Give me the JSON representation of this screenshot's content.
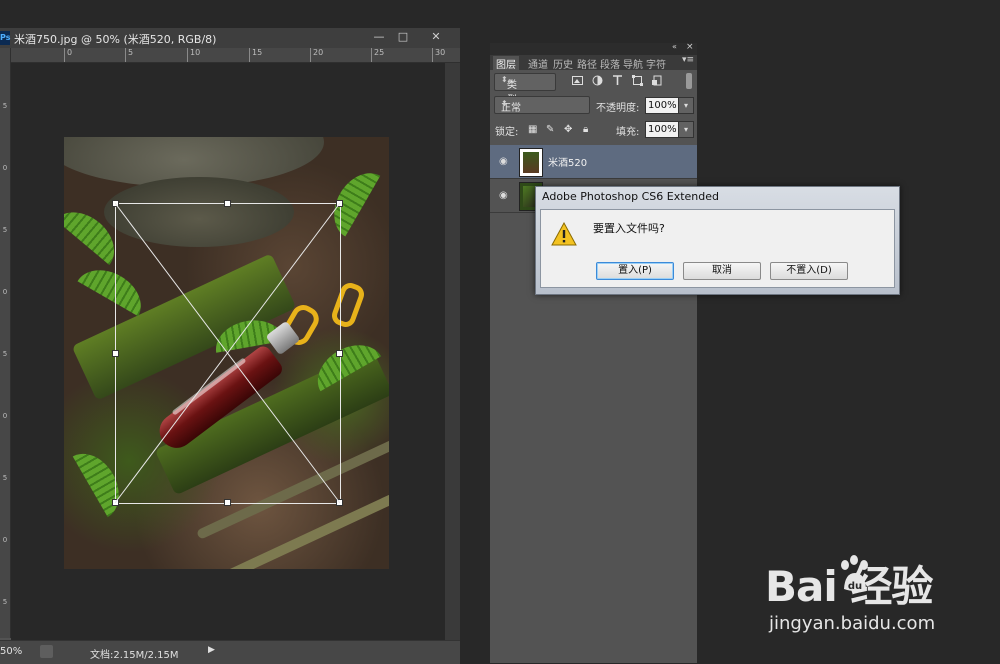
{
  "document": {
    "title": "米酒750.jpg @ 50% (米酒520, RGB/8)",
    "app_icon": "Ps",
    "window_buttons": {
      "minimize": "—",
      "maximize": "□",
      "close": "✕"
    },
    "ruler_h_ticks": [
      "0",
      "5",
      "10",
      "15",
      "20",
      "25",
      "30"
    ],
    "ruler_v_ticks": [
      "5",
      "0",
      "5",
      "0",
      "5",
      "0",
      "5",
      "0",
      "5",
      "0"
    ],
    "zoom": "50%",
    "doc_size": "文档:2.15M/2.15M",
    "status_arrow": "▶"
  },
  "layers_panel": {
    "tabs": [
      "图层",
      "通道",
      "历史",
      "路径",
      "段落",
      "导航",
      "字符"
    ],
    "collapse_icon": "«",
    "close_icon": "×",
    "menu_icon": "▾≡",
    "filter": {
      "icon": "⌕",
      "label": "类型"
    },
    "blend_mode": "正常",
    "opacity_label": "不透明度:",
    "opacity_value": "100%",
    "lock_label": "锁定:",
    "fill_label": "填充:",
    "fill_value": "100%",
    "layers": [
      {
        "name": "米酒520",
        "visible": true,
        "selected": true
      },
      {
        "name": "",
        "visible": true,
        "selected": false
      }
    ]
  },
  "dialog": {
    "title": "Adobe Photoshop CS6 Extended",
    "message": "要置入文件吗?",
    "buttons": {
      "place": "置入(P)",
      "cancel": "取消",
      "dont_place": "不置入(D)"
    }
  },
  "watermark": {
    "logo": "Bai 经验",
    "url": "jingyan.baidu.com"
  }
}
